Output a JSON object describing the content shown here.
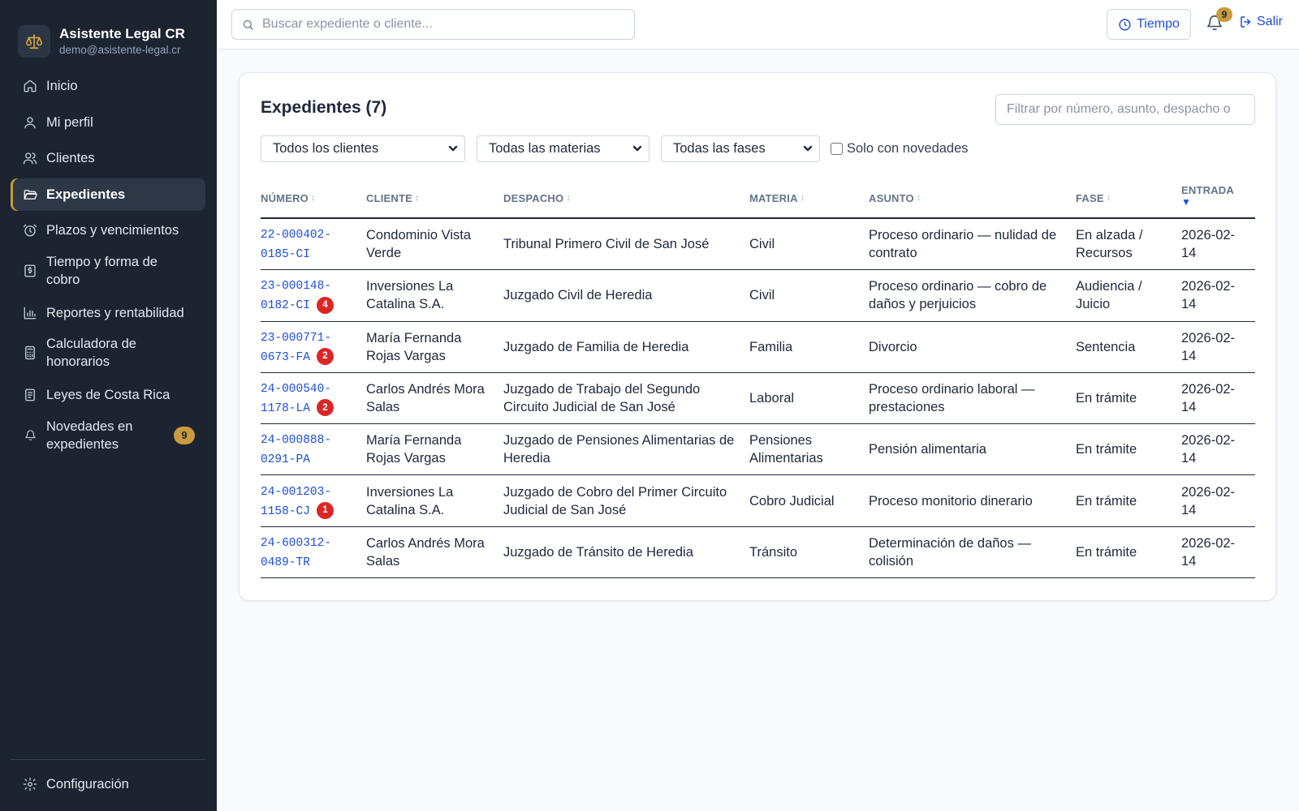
{
  "brand": {
    "title": "Asistente Legal CR",
    "email": "demo@asistente-legal.cr"
  },
  "sidebar": {
    "items": [
      {
        "label": "Inicio"
      },
      {
        "label": "Mi perfil"
      },
      {
        "label": "Clientes"
      },
      {
        "label": "Expedientes",
        "active": true
      },
      {
        "label": "Plazos y vencimientos"
      },
      {
        "label": "Tiempo y forma de cobro"
      },
      {
        "label": "Reportes y rentabilidad"
      },
      {
        "label": "Calculadora de honorarios"
      },
      {
        "label": "Leyes de Costa Rica"
      },
      {
        "label": "Novedades en expedientes",
        "badge": "9"
      }
    ],
    "settings_label": "Configuración"
  },
  "topbar": {
    "search_placeholder": "Buscar expediente o cliente...",
    "time_label": "Tiempo",
    "notifications_count": "9",
    "logout_label": "Salir"
  },
  "main": {
    "title": "Expedientes (7)",
    "filter_placeholder": "Filtrar por número, asunto, despacho o",
    "filters": {
      "clients": "Todos los clientes",
      "subjects": "Todas las materias",
      "phases": "Todas las fases",
      "only_news_label": "Solo con novedades"
    },
    "table": {
      "headers": [
        "NÚMERO",
        "CLIENTE",
        "DESPACHO",
        "MATERIA",
        "ASUNTO",
        "FASE",
        "ENTRADA"
      ],
      "rows": [
        {
          "numero": "22-000402-0185-CI",
          "badge": "",
          "cliente": "Condominio Vista Verde",
          "despacho": "Tribunal Primero Civil de San José",
          "materia": "Civil",
          "asunto": "Proceso ordinario — nulidad de contrato",
          "fase": "En alzada / Recursos",
          "entrada": "2026-02-14"
        },
        {
          "numero": "23-000148-0182-CI",
          "badge": "4",
          "cliente": "Inversiones La Catalina S.A.",
          "despacho": "Juzgado Civil de Heredia",
          "materia": "Civil",
          "asunto": "Proceso ordinario — cobro de daños y perjuicios",
          "fase": "Audiencia / Juicio",
          "entrada": "2026-02-14"
        },
        {
          "numero": "23-000771-0673-FA",
          "badge": "2",
          "cliente": "María Fernanda Rojas Vargas",
          "despacho": "Juzgado de Familia de Heredia",
          "materia": "Familia",
          "asunto": "Divorcio",
          "fase": "Sentencia",
          "entrada": "2026-02-14"
        },
        {
          "numero": "24-000540-1178-LA",
          "badge": "2",
          "cliente": "Carlos Andrés Mora Salas",
          "despacho": "Juzgado de Trabajo del Segundo Circuito Judicial de San José",
          "materia": "Laboral",
          "asunto": "Proceso ordinario laboral — prestaciones",
          "fase": "En trámite",
          "entrada": "2026-02-14"
        },
        {
          "numero": "24-000888-0291-PA",
          "badge": "",
          "cliente": "María Fernanda Rojas Vargas",
          "despacho": "Juzgado de Pensiones Alimentarias de Heredia",
          "materia": "Pensiones Alimentarias",
          "asunto": "Pensión alimentaria",
          "fase": "En trámite",
          "entrada": "2026-02-14"
        },
        {
          "numero": "24-001203-1158-CJ",
          "badge": "1",
          "cliente": "Inversiones La Catalina S.A.",
          "despacho": "Juzgado de Cobro del Primer Circuito Judicial de San José",
          "materia": "Cobro Judicial",
          "asunto": "Proceso monitorio dinerario",
          "fase": "En trámite",
          "entrada": "2026-02-14"
        },
        {
          "numero": "24-600312-0489-TR",
          "badge": "",
          "cliente": "Carlos Andrés Mora Salas",
          "despacho": "Juzgado de Tránsito de Heredia",
          "materia": "Tránsito",
          "asunto": "Determinación de daños — colisión",
          "fase": "En trámite",
          "entrada": "2026-02-14"
        }
      ]
    }
  },
  "colors": {
    "sidebar_bg": "#1c2431",
    "accent_gold": "#c89b3c",
    "link_blue": "#1d4ed8",
    "badge_red": "#dc2626"
  }
}
